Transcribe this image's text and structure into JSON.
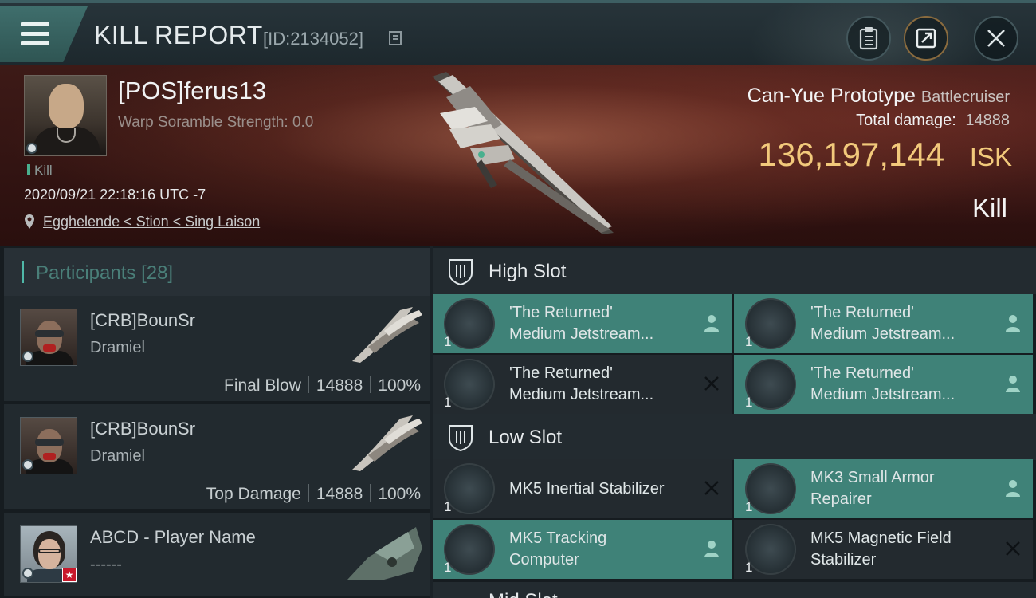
{
  "header": {
    "title": "KILL REPORT",
    "id_text": "[ID:2134052]"
  },
  "victim": {
    "name": "[POS]ferus13",
    "scramble": "Warp Soramble Strength: 0.0",
    "tag": "Kill",
    "datetime": "2020/09/21 22:18:16 UTC -7",
    "location": "Egghelende < Stion < Sing Laison",
    "ship_name": "Can-Yue Prototype",
    "ship_class": "Battlecruiser",
    "damage_label": "Total damage:",
    "damage_value": "14888",
    "isk_value": "136,197,144",
    "isk_currency": "ISK",
    "outcome": "Kill"
  },
  "participants": {
    "label": "Participants",
    "count": "[28]",
    "rows": [
      {
        "name": "[CRB]BounSr",
        "sub": "Dramiel",
        "role": "Final Blow",
        "damage": "14888",
        "percent": "100%"
      },
      {
        "name": "[CRB]BounSr",
        "sub": "Dramiel",
        "role": "Top Damage",
        "damage": "14888",
        "percent": "100%"
      },
      {
        "name": "ABCD - Player Name",
        "sub": "------",
        "role": "",
        "damage": "",
        "percent": ""
      }
    ]
  },
  "fitting": {
    "high_slot": {
      "label": "High Slot",
      "modules": [
        {
          "line1": "'The Returned'",
          "line2": "Medium Jetstream...",
          "qty": "1",
          "state": "person"
        },
        {
          "line1": "'The Returned'",
          "line2": "Medium Jetstream...",
          "qty": "1",
          "state": "person"
        },
        {
          "line1": "'The Returned'",
          "line2": "Medium Jetstream...",
          "qty": "1",
          "state": "destroyed"
        },
        {
          "line1": "'The Returned'",
          "line2": "Medium Jetstream...",
          "qty": "1",
          "state": "person"
        }
      ]
    },
    "low_slot": {
      "label": "Low Slot",
      "modules": [
        {
          "line1": "MK5 Inertial Stabilizer",
          "line2": "",
          "qty": "1",
          "state": "destroyed"
        },
        {
          "line1": "MK3 Small Armor",
          "line2": "Repairer",
          "qty": "1",
          "state": "person"
        },
        {
          "line1": "MK5 Tracking",
          "line2": "Computer",
          "qty": "1",
          "state": "person"
        },
        {
          "line1": "MK5 Magnetic Field",
          "line2": "Stabilizer",
          "qty": "1",
          "state": "destroyed"
        }
      ]
    },
    "next_slot_partial": "Mid Slot"
  },
  "colors": {
    "accent": "#3f8278",
    "isk": "#f2c97b",
    "kill_marker": "#49b08e"
  }
}
